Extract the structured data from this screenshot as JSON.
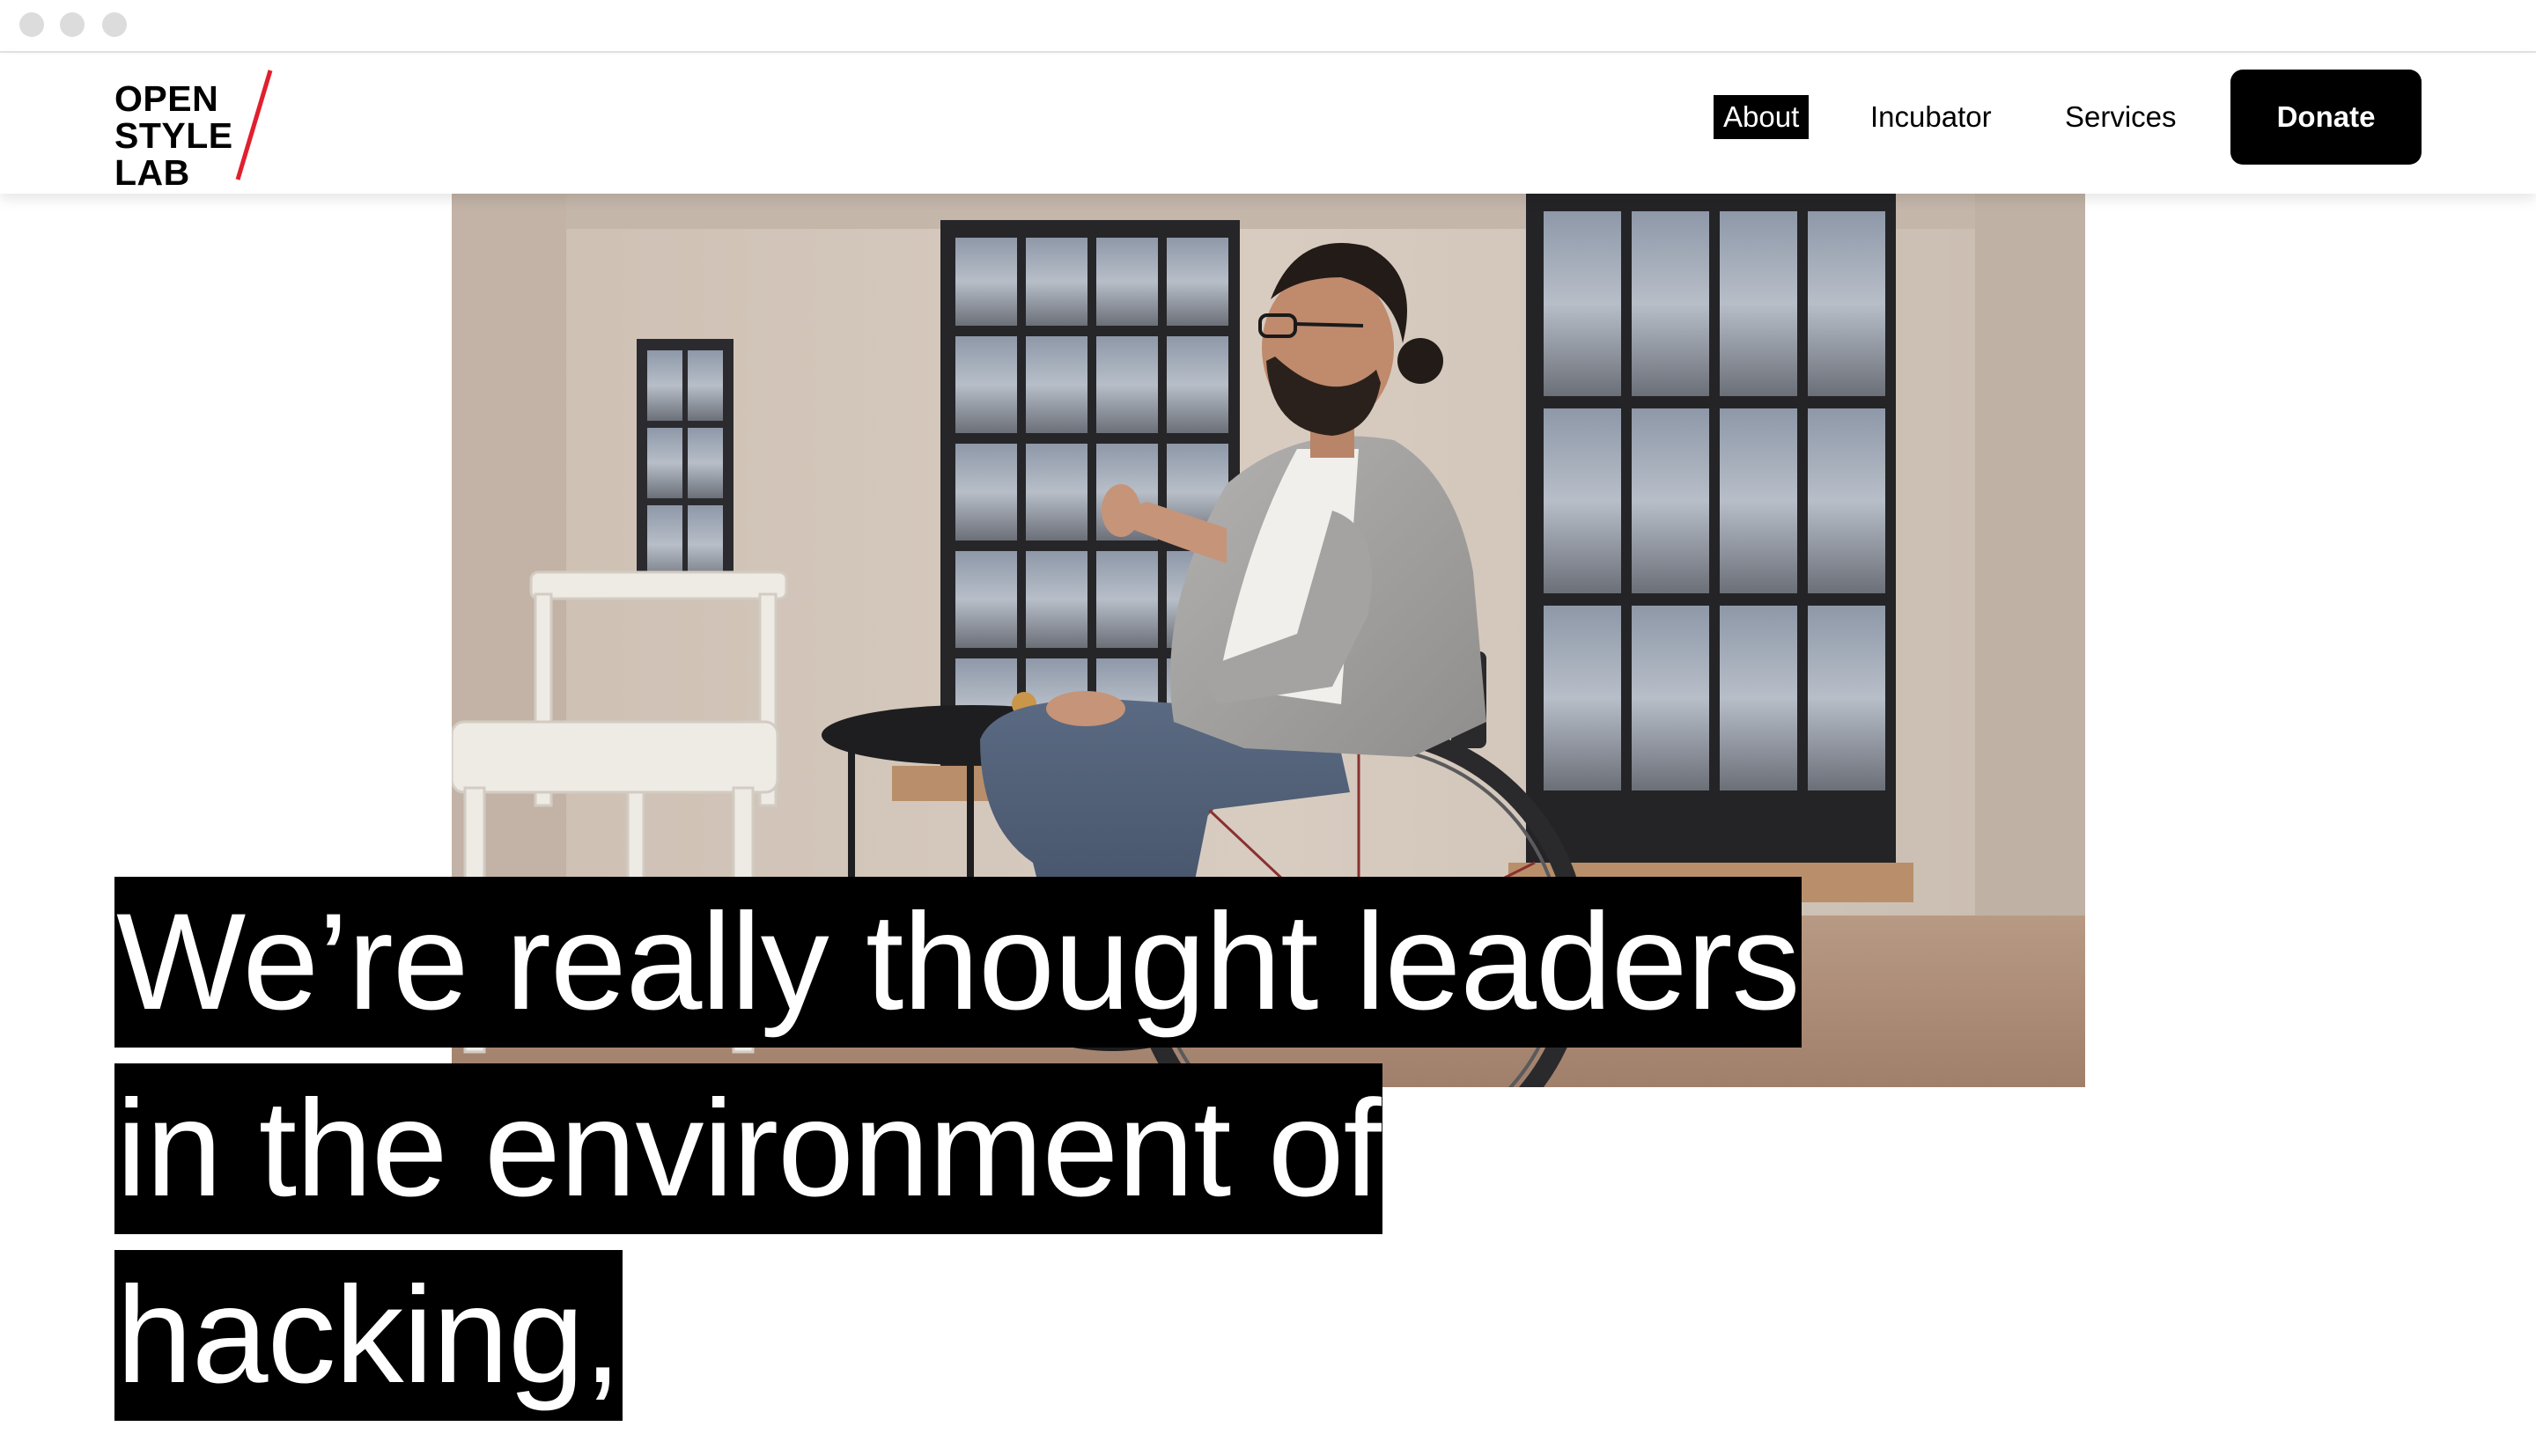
{
  "header": {
    "logo": {
      "lines": [
        "OPEN",
        "STYLE",
        "LAB"
      ],
      "accent_color": "#e0202e"
    },
    "nav": [
      {
        "label": "About",
        "active": true
      },
      {
        "label": "Incubator",
        "active": false
      },
      {
        "label": "Services",
        "active": false
      }
    ],
    "donate_label": "Donate"
  },
  "hero": {
    "image": "man-in-wheelchair-speaking-photo"
  },
  "headline": {
    "lines": [
      "We’re really thought leaders",
      "in the environment of",
      "hacking,"
    ]
  },
  "colors": {
    "background": "#ffffff",
    "text": "#000000",
    "highlight_bg": "#000000",
    "highlight_text": "#ffffff"
  }
}
